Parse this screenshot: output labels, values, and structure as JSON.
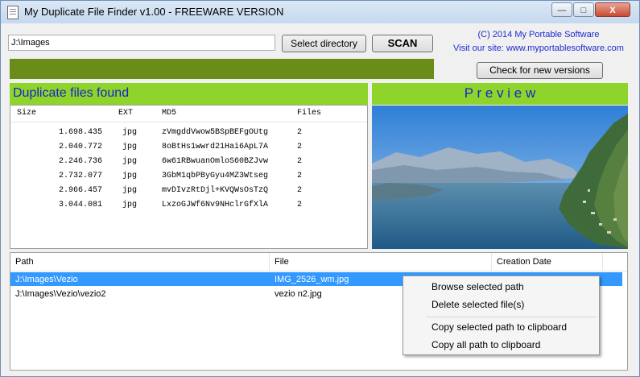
{
  "window": {
    "title": "My Duplicate File Finder v1.00 - FREEWARE VERSION"
  },
  "titlebar_buttons": {
    "minimize": "—",
    "maximize": "□",
    "close": "X"
  },
  "toolbar": {
    "path_value": "J:\\Images",
    "select_directory_label": "Select directory",
    "scan_label": "SCAN",
    "copyright": "(C) 2014 My Portable Software",
    "site": "Visit our site: www.myportablesoftware.com",
    "check_versions_label": "Check for new versions"
  },
  "duplicates": {
    "title": "Duplicate files found",
    "columns": [
      "Size",
      "EXT",
      "MD5",
      "Files"
    ],
    "rows": [
      {
        "size": "1.698.435",
        "ext": "jpg",
        "md5": "zVmgddVwow5BSpBEFgOUtg",
        "files": "2"
      },
      {
        "size": "2.040.772",
        "ext": "jpg",
        "md5": "8oBtHs1wwrd21Hai6ApL7A",
        "files": "2"
      },
      {
        "size": "2.246.736",
        "ext": "jpg",
        "md5": "6w61RBwuanOmloS60BZJvw",
        "files": "2"
      },
      {
        "size": "2.732.077",
        "ext": "jpg",
        "md5": "3GbM1qbPByGyu4MZ3Wtseg",
        "files": "2"
      },
      {
        "size": "2.966.457",
        "ext": "jpg",
        "md5": "mvDIvzRtDjl+KVQWsOsTzQ",
        "files": "2"
      },
      {
        "size": "3.044.081",
        "ext": "jpg",
        "md5": "LxzoGJWf6Nv9NHclrGfXlA",
        "files": "2"
      }
    ]
  },
  "preview": {
    "title": "P r e v i e w"
  },
  "files": {
    "columns": [
      "Path",
      "File",
      "Creation Date"
    ],
    "rows": [
      {
        "path": "J:\\Images\\Vezio",
        "file": "IMG_2526_wm.jpg",
        "date": ""
      },
      {
        "path": "J:\\Images\\Vezio\\vezio2",
        "file": "vezio n2.jpg",
        "date": ""
      }
    ]
  },
  "context_menu": {
    "items": [
      "Browse selected path",
      "Delete selected file(s)",
      "Copy selected path to clipboard",
      "Copy all path to clipboard"
    ]
  },
  "colors": {
    "accent_green": "#8fd42b",
    "progress_green": "#6a8c19",
    "header_text": "#1427c8",
    "selection": "#3399ff"
  }
}
